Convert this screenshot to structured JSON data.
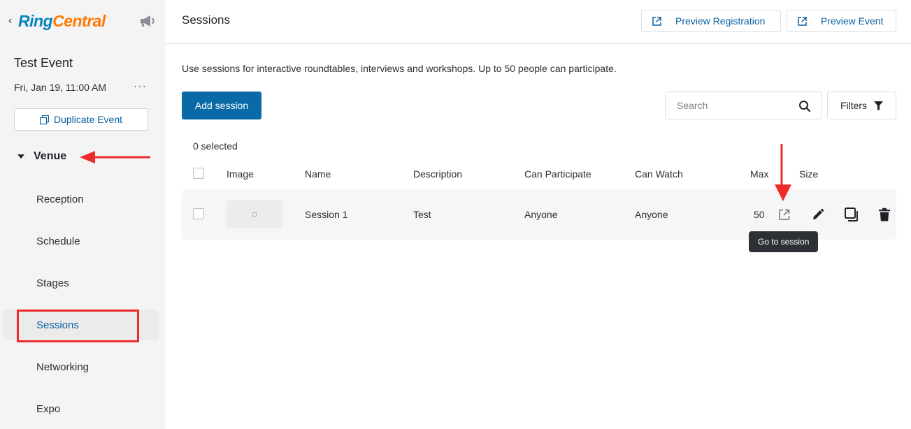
{
  "sidebar": {
    "back_glyph": "‹",
    "logo_ring": "Ring",
    "logo_central": "Central",
    "logo_ring_color": "#0684bd",
    "logo_central_color": "#ff7a00",
    "announce_icon": "megaphone-icon",
    "event_title": "Test Event",
    "event_date": "Fri, Jan 19, 11:00 AM",
    "more_glyph": "···",
    "duplicate_label": "Duplicate Event",
    "venue_label": "Venue",
    "nav_items": [
      {
        "label": "Reception"
      },
      {
        "label": "Schedule"
      },
      {
        "label": "Stages"
      },
      {
        "label": "Sessions",
        "active": true
      },
      {
        "label": "Networking"
      },
      {
        "label": "Expo"
      }
    ]
  },
  "header": {
    "title": "Sessions",
    "preview_registration_label": "Preview Registration",
    "preview_event_label": "Preview Event"
  },
  "main": {
    "intro": "Use sessions for interactive roundtables, interviews and workshops. Up to 50 people can participate.",
    "add_session_label": "Add session",
    "search_placeholder": "Search",
    "filters_label": "Filters",
    "selected_count": "0 selected",
    "table": {
      "columns": [
        "Image",
        "Name",
        "Description",
        "Can Participate",
        "Can Watch",
        "Max",
        "Size"
      ],
      "rows": [
        {
          "name": "Session 1",
          "description": "Test",
          "can_participate": "Anyone",
          "can_watch": "Anyone",
          "max": "50"
        }
      ]
    },
    "tooltip": "Go to session"
  },
  "colors": {
    "accent": "#0b62a4",
    "primary_button": "#0a6aa8",
    "annotation_red": "#ee2a2a"
  }
}
